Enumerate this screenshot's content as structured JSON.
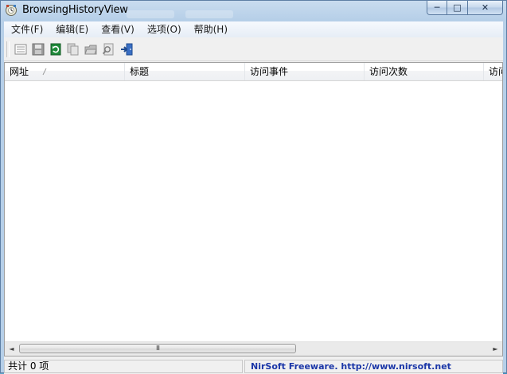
{
  "window": {
    "title": "BrowsingHistoryView",
    "controls": {
      "minimize": "─",
      "maximize": "□",
      "close": "✕"
    }
  },
  "menu": {
    "items": [
      {
        "label": "文件(F)"
      },
      {
        "label": "编辑(E)"
      },
      {
        "label": "查看(V)"
      },
      {
        "label": "选项(O)"
      },
      {
        "label": "帮助(H)"
      }
    ]
  },
  "toolbar": {
    "buttons": [
      {
        "icon": "properties-icon"
      },
      {
        "icon": "save-icon"
      },
      {
        "icon": "refresh-icon"
      },
      {
        "icon": "copy-icon"
      },
      {
        "icon": "open-folder-icon"
      },
      {
        "icon": "find-icon"
      },
      {
        "icon": "exit-icon"
      }
    ]
  },
  "listview": {
    "columns": [
      {
        "label": "网址"
      },
      {
        "label": "标题"
      },
      {
        "label": "访问事件"
      },
      {
        "label": "访问次数"
      },
      {
        "label": "访问"
      }
    ],
    "rows": [],
    "scroll_arrows": {
      "left": "◄",
      "right": "►"
    },
    "scroll_grip": "III"
  },
  "status": {
    "count": "共计 0 项",
    "credit": "NirSoft Freeware.  http://www.nirsoft.net"
  },
  "colors": {
    "titlebar": "#b6cfe8",
    "credit_link": "#1b37a8",
    "list_bg": "#ffffff"
  }
}
